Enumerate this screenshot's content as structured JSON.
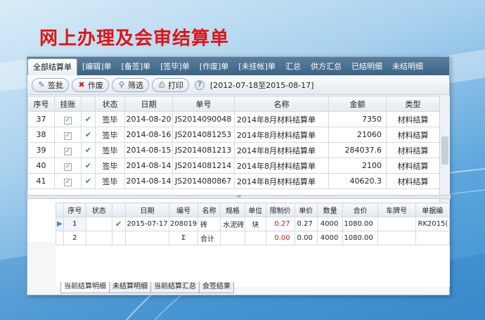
{
  "headline": "网上办理及会审结算单",
  "tabs": [
    "全部结算单",
    "[编辑]单",
    "[备签]单",
    "[签毕]单",
    "[作废]单",
    "[未挂帐]单",
    "汇总",
    "供方汇总",
    "已结明细",
    "未结明细"
  ],
  "toolbar": {
    "sign_label": "签批",
    "void_label": "作废",
    "filter_label": "筛选",
    "print_label": "打印",
    "help": "?",
    "date_range": "[2012-07-18至2015-08-17]"
  },
  "upper_table": {
    "headers": [
      "序号",
      "挂账",
      "",
      "状态",
      "日期",
      "单号",
      "名称",
      "金额",
      "类型"
    ],
    "rows": [
      {
        "no": "37",
        "status": "签毕",
        "date": "2014-08-20",
        "code": "JS2014090048",
        "name": "2014年8月材料结算单",
        "amount": "7350",
        "type": "材料结算"
      },
      {
        "no": "38",
        "status": "签毕",
        "date": "2014-08-16",
        "code": "JS2014081253",
        "name": "2014年8月材料结算单",
        "amount": "21060",
        "type": "材料结算"
      },
      {
        "no": "39",
        "status": "签毕",
        "date": "2014-08-15",
        "code": "JS2014081213",
        "name": "2014年8月材料结算单",
        "amount": "284037.6",
        "type": "材料结算"
      },
      {
        "no": "40",
        "status": "签毕",
        "date": "2014-08-14",
        "code": "JS2014081214",
        "name": "2014年8月材料结算单",
        "amount": "2100",
        "type": "材料结算"
      },
      {
        "no": "41",
        "status": "签毕",
        "date": "2014-08-14",
        "code": "JS2014080867",
        "name": "2014年8月材料结算单",
        "amount": "40620.3",
        "type": "材料结算"
      }
    ]
  },
  "lower_table": {
    "headers": [
      "序号",
      "状态",
      "日期",
      "编号",
      "名称",
      "规格",
      "单位",
      "限制价",
      "单价",
      "数量",
      "合价",
      "车牌号",
      "单据编"
    ],
    "rows": [
      {
        "no": "1",
        "date": "2015-07-17",
        "code": "208019",
        "name": "砖",
        "spec": "水泥砖",
        "unit": "块",
        "limit": "0.27",
        "price": "0.27",
        "qty": "4000",
        "total": "1080.00",
        "plate": "",
        "doc": "RK2015("
      },
      {
        "no": "2",
        "date": "",
        "code": "Σ",
        "name": "合计",
        "spec": "",
        "unit": "",
        "limit": "0.00",
        "price": "0.00",
        "qty": "4000",
        "total": "1080.00",
        "plate": "",
        "doc": ""
      }
    ]
  },
  "bottom_tabs": [
    "当前结算明细",
    "未结算明细",
    "当前结算汇总",
    "会签结果"
  ],
  "colors": {
    "headline": "#e01414",
    "tabbar": "#4a7090",
    "accent": "#2c9b2c"
  }
}
